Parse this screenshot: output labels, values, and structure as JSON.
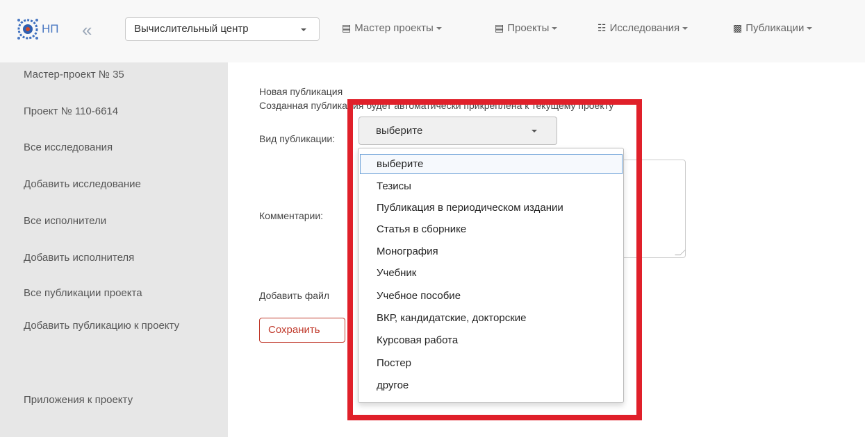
{
  "navbar": {
    "brand": "НП",
    "collapse_glyph": "«",
    "center_select": "Вычислительный центр",
    "items": [
      {
        "label": "Мастер проекты",
        "icon": "list-icon"
      },
      {
        "label": "Проекты",
        "icon": "list-icon"
      },
      {
        "label": "Исследования",
        "icon": "sitemap-icon"
      },
      {
        "label": "Публикации",
        "icon": "book-icon"
      }
    ]
  },
  "sidebar": {
    "items": [
      "Мастер-проект № 35",
      "Проект № 110-6614",
      "Все исследования",
      "Добавить исследование",
      "Все исполнители",
      "Добавить исполнителя",
      "Все публикации проекта",
      "Добавить публикацию к проекту",
      "Приложения к проекту"
    ]
  },
  "form": {
    "title": "Новая публикация",
    "note": "Созданная публикация будет автоматически прикреплена к текущему проекту",
    "type_label": "Вид публикации:",
    "type_value": "выберите",
    "comment_label": "Комментарии:",
    "file_label": "Добавить файл",
    "save_label": "Сохранить"
  },
  "dropdown": {
    "options": [
      "выберите",
      "Тезисы",
      "Публикация в периодическом издании",
      "Статья в сборнике",
      "Монография",
      "Учебник",
      "Учебное пособие",
      "ВКР, кандидатские, докторские",
      "Курсовая работа",
      "Постер",
      "другое"
    ]
  },
  "colors": {
    "highlight": "#e0202a",
    "save_button": "#c0392b",
    "brand": "#4a78c2"
  }
}
